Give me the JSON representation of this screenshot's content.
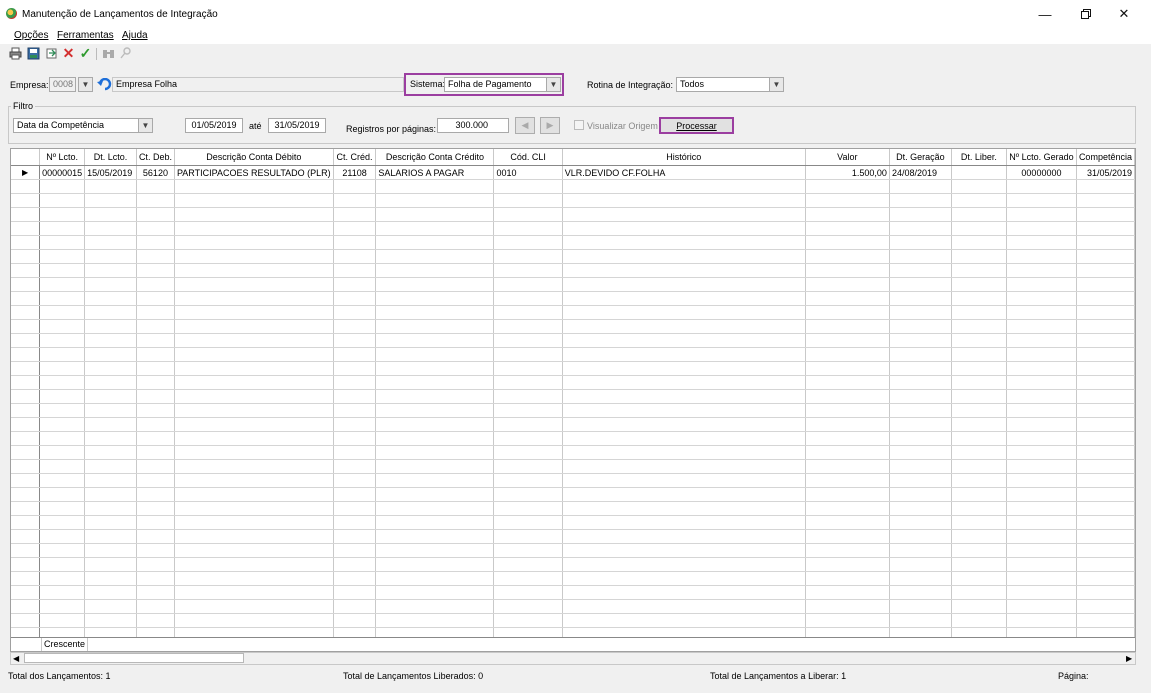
{
  "window": {
    "title": "Manutenção de Lançamentos de Integração"
  },
  "menu": [
    "Opções",
    "Ferramentas",
    "Ajuda"
  ],
  "toolbar_icons": [
    "print-icon",
    "save-icon",
    "export-icon",
    "delete-icon",
    "confirm-icon",
    "binoculars-icon",
    "key-icon"
  ],
  "empresa": {
    "label": "Empresa:",
    "code": "0008",
    "name": "Empresa Folha"
  },
  "sistema": {
    "label": "Sistema:",
    "value": "Folha de Pagamento"
  },
  "rotina": {
    "label": "Rotina de Integração:",
    "value": "Todos"
  },
  "filtro": {
    "title": "Filtro",
    "type": "Data da Competência",
    "date_from": "01/05/2019",
    "ate_label": "até",
    "date_to": "31/05/2019",
    "registros_label": "Registros por páginas:",
    "registros_value": "300.000",
    "visualizar_label": "Visualizar Origem",
    "processar_label": "Processar"
  },
  "grid": {
    "columns": [
      "Nº Lcto.",
      "Dt. Lcto.",
      "Ct. Deb.",
      "Descrição Conta Débito",
      "Ct. Créd.",
      "Descrição Conta Crédito",
      "Cód. CLI",
      "Histórico",
      "Valor",
      "Dt. Geração",
      "Dt. Liber.",
      "Nº Lcto. Gerado",
      "Competência"
    ],
    "rows": [
      [
        "00000015",
        "15/05/2019",
        "56120",
        "PARTICIPACOES RESULTADO (PLR)",
        "21108",
        "SALARIOS A PAGAR",
        "0010",
        "VLR.DEVIDO CF.FOLHA",
        "1.500,00",
        "24/08/2019",
        "",
        "00000000",
        "31/05/2019"
      ]
    ],
    "footer_label": "Crescente"
  },
  "status": {
    "total": "Total dos Lançamentos: 1",
    "liberados": "Total de Lançamentos Liberados: 0",
    "a_liberar": "Total de Lançamentos a Liberar: 1",
    "pagina": "Página:"
  },
  "colors": {
    "highlight": "#9b3ea0",
    "background": "#f0f0f0"
  }
}
